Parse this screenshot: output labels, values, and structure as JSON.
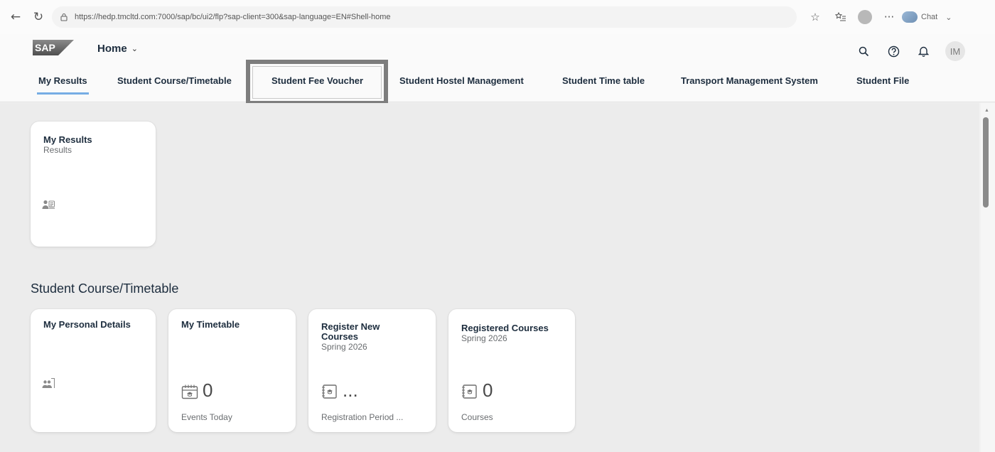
{
  "browser": {
    "url": "https://hedp.tmcltd.com:7000/sap/bc/ui2/flp?sap-client=300&sap-language=EN#Shell-home",
    "chat_label": "Chat"
  },
  "shell": {
    "logo_text": "SAP",
    "home_label": "Home",
    "user_initials": "IM"
  },
  "tabs": [
    {
      "label": "My Results",
      "active": true
    },
    {
      "label": "Student Course/Timetable"
    },
    {
      "label": "Student Fee Voucher",
      "highlighted": true
    },
    {
      "label": "Student Hostel Management"
    },
    {
      "label": "Student Time table"
    },
    {
      "label": "Transport Management System"
    },
    {
      "label": "Student File"
    }
  ],
  "my_results": {
    "tile": {
      "title": "My Results",
      "subtitle": "Results",
      "icon": "student-grades-icon"
    }
  },
  "course_section": {
    "title": "Student Course/Timetable",
    "tiles": [
      {
        "title": "My Personal Details",
        "icon": "personal-details-icon"
      },
      {
        "title": "My Timetable",
        "icon": "calendar-icon",
        "kpi": "0",
        "footer": "Events Today"
      },
      {
        "title": "Register New Courses",
        "subtitle": "Spring 2026",
        "icon": "course-book-icon",
        "kpi": "...",
        "footer": "Registration Period ..."
      },
      {
        "title": "Registered Courses",
        "subtitle": "Spring 2026",
        "icon": "course-book-icon",
        "kpi": "0",
        "footer": "Courses"
      }
    ]
  },
  "colors": {
    "accent": "#0a6ed1",
    "text": "#1d2d3e",
    "background": "#ececec"
  }
}
